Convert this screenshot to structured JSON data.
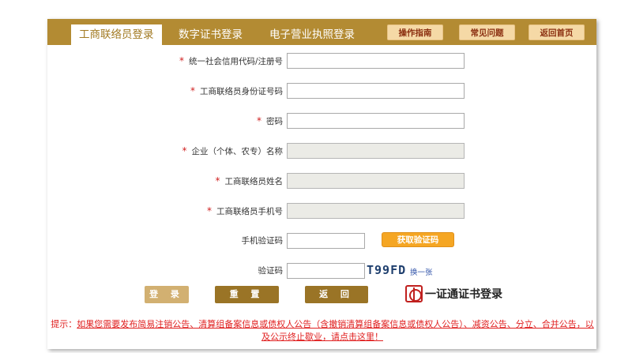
{
  "tabs": [
    {
      "label": "工商联络员登录",
      "active": true
    },
    {
      "label": "数字证书登录",
      "active": false
    },
    {
      "label": "电子营业执照登录",
      "active": false
    }
  ],
  "header_buttons": {
    "guide": "操作指南",
    "faq": "常见问题",
    "home": "返回首页"
  },
  "form": {
    "required_mark": "*",
    "credit_code_label": "统一社会信用代码/注册号",
    "id_number_label": "工商联络员身份证号码",
    "password_label": "密码",
    "company_name_label": "企业（个体、农专）名称",
    "liaison_name_label": "工商联络员姓名",
    "liaison_phone_label": "工商联络员手机号",
    "sms_code_label": "手机验证码",
    "get_code_button": "获取验证码",
    "captcha_label": "验证码",
    "captcha_text": "T99FD",
    "refresh_captcha": "换一张"
  },
  "actions": {
    "login": "登 录",
    "reset": "重 置",
    "back": "返 回",
    "cert_login": "一证通证书登录"
  },
  "notice": {
    "prefix": "提示：",
    "text": "如果您需要发布简易注销公告、清算组备案信息或债权人公告（含撤销清算组备案信息或债权人公告）、减资公告、分立、合并公告，以及公示终止歇业，请点击这里！"
  },
  "colors": {
    "header": "#b38b33",
    "accent_text": "#a27a22",
    "required": "#d02020",
    "notice": "#e02020",
    "get_code": "#f5a623"
  }
}
